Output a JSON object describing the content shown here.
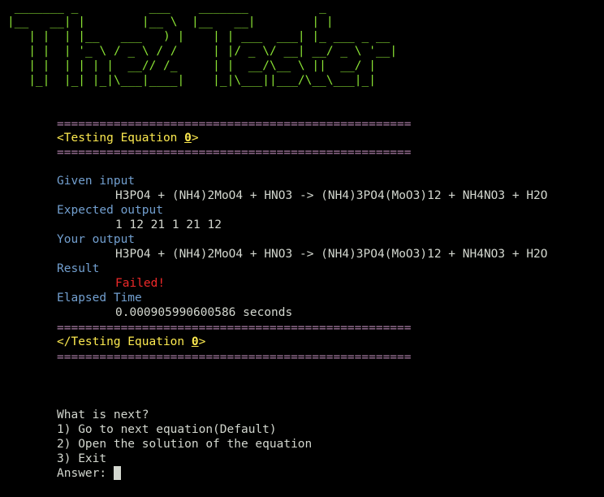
{
  "banner": {
    "art": " _______ _          ___    _______          _\n|__   __| |        |__ \\  |__   __|        | |\n   | |  | |__   ___   ) |    | | ___  ___| |_ ___ _ __\n   | |  | '_ \\ / _ \\ / /     | |/ _ \\/ __| __/ _ \\ '__|\n   | |  | | | |  __// /_     | |  __/\\__ \\ ||  __/ |\n   |_|  |_| |_|\\___|____|    |_|\\___||___/\\__\\___|_|"
  },
  "test": {
    "rule": "==================================================",
    "open_tag_prefix": "<Testing Equation ",
    "equation_number": "0",
    "open_tag_suffix": ">",
    "close_tag_prefix": "</Testing Equation ",
    "close_tag_suffix": ">",
    "given_input_label": "Given input",
    "given_input_value": "H3PO4 + (NH4)2MoO4 + HNO3 -> (NH4)3PO4(MoO3)12 + NH4NO3 + H2O",
    "expected_output_label": "Expected output",
    "expected_output_value": "1 12 21 1 21 12",
    "your_output_label": "Your output",
    "your_output_value": "H3PO4 + (NH4)2MoO4 + HNO3 -> (NH4)3PO4(MoO3)12 + NH4NO3 + H2O",
    "result_label": "Result",
    "result_value": "Failed!",
    "elapsed_label": "Elapsed Time",
    "elapsed_value": "0.000905990600586 seconds"
  },
  "menu": {
    "question": "What is next?",
    "option_1": "1) Go to next equation(Default)",
    "option_2": "2) Open the solution of the equation",
    "option_3": "3) Exit",
    "prompt": "Answer: "
  },
  "colors": {
    "background": "#000000",
    "banner": "#8ae234",
    "rule": "#ad7fa8",
    "label": "#729fcf",
    "tag": "#fce94f",
    "failed": "#ef2929",
    "text": "#d3d7cf"
  }
}
